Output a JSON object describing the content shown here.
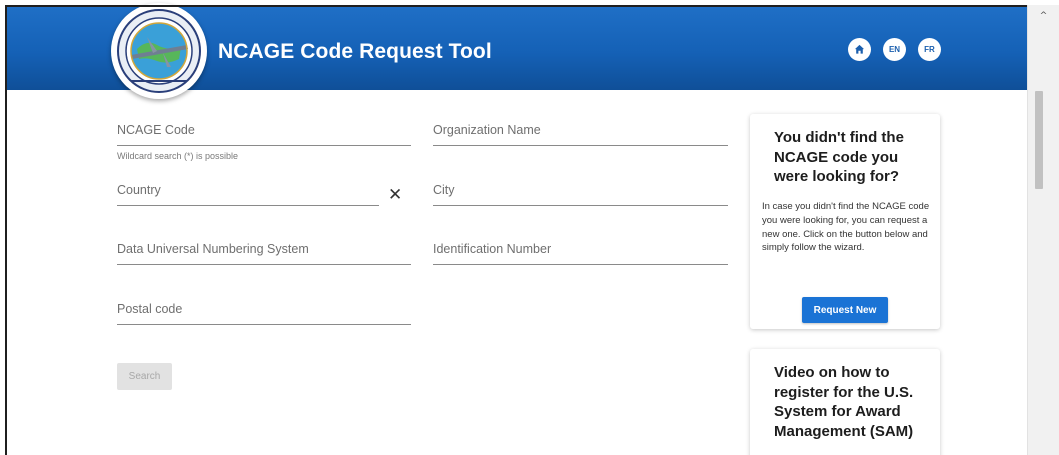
{
  "header": {
    "logo_icon": "ncs-emblem-logo",
    "title": "NCAGE Code Request Tool",
    "buttons": {
      "home_icon": "home-icon",
      "lang_en": "EN",
      "lang_fr": "FR"
    },
    "colors": {
      "brand_blue": "#1561b6"
    }
  },
  "form": {
    "ncage_code_label": "NCAGE Code",
    "ncage_code_hint": "Wildcard search (*) is possible",
    "organization_name_label": "Organization Name",
    "country_label": "Country",
    "country_clear": "✕",
    "city_label": "City",
    "duns_label": "Data Universal Numbering System",
    "identification_number_label": "Identification Number",
    "postal_code_label": "Postal code",
    "search_button": "Search"
  },
  "sidebar": {
    "not_found_card": {
      "title": "You didn't find the NCAGE code you were looking for?",
      "text": "In case you didn't find the NCAGE code you were looking for, you can request a new one. Click on the button below and simply follow the wizard.",
      "button": "Request New",
      "button_color": "#1a73d5"
    },
    "video_card": {
      "title": "Video on how to register for the U.S. System for Award Management (SAM)"
    }
  },
  "scrollbar": {
    "up_arrow": "^"
  }
}
